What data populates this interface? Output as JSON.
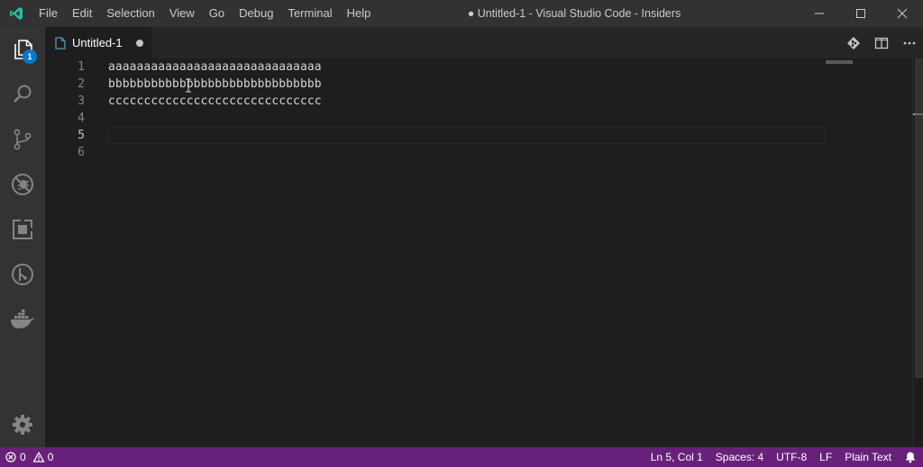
{
  "window": {
    "title": "● Untitled-1 - Visual Studio Code - Insiders"
  },
  "menu": {
    "items": [
      "File",
      "Edit",
      "Selection",
      "View",
      "Go",
      "Debug",
      "Terminal",
      "Help"
    ]
  },
  "activity_bar": {
    "explorer_badge": "1",
    "icons": [
      "files-icon",
      "search-icon",
      "source-control-icon",
      "debug-icon",
      "extensions-icon",
      "remote-icon",
      "docker-icon",
      "settings-gear-icon"
    ]
  },
  "tab": {
    "label": "Untitled-1"
  },
  "editor": {
    "lines": [
      {
        "number": "1",
        "text": "aaaaaaaaaaaaaaaaaaaaaaaaaaaaaa"
      },
      {
        "number": "2",
        "text": "bbbbbbbbbbbbbbbbbbbbbbbbbbbbbb"
      },
      {
        "number": "3",
        "text": "cccccccccccccccccccccccccccccc"
      },
      {
        "number": "4",
        "text": ""
      },
      {
        "number": "5",
        "text": ""
      },
      {
        "number": "6",
        "text": ""
      }
    ],
    "active_line": "5"
  },
  "status": {
    "errors": "0",
    "warnings": "0",
    "position": "Ln 5, Col 1",
    "indent": "Spaces: 4",
    "encoding": "UTF-8",
    "eol": "LF",
    "language": "Plain Text"
  },
  "colors": {
    "status_bar": "#68217a",
    "accent": "#007acc",
    "insiders_logo": "#24bfa5"
  }
}
